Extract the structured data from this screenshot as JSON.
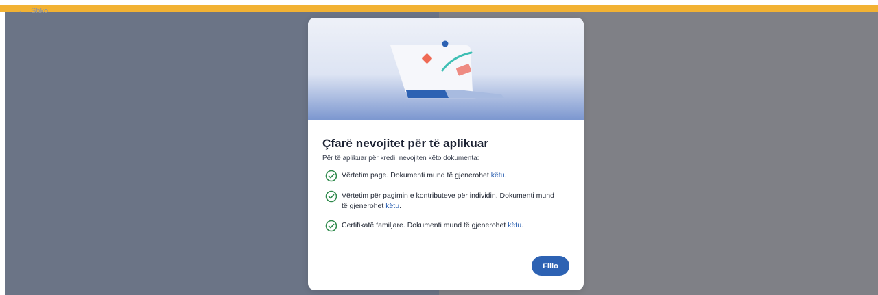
{
  "background": {
    "back_label": "Shko"
  },
  "modal": {
    "title": "Çfarë nevojitet për të aplikuar",
    "subtitle": "Për të aplikuar për kredi, nevojiten këto dokumenta:",
    "requirements": [
      {
        "text": "Vërtetim page. Dokumenti mund të gjenerohet ",
        "link": "këtu"
      },
      {
        "text": "Vërtetim për pagimin e kontributeve për individin. Dokumenti mund të gjenerohet ",
        "link": "këtu"
      },
      {
        "text": "Certifikatë familjare. Dokumenti mund të gjenerohet ",
        "link": "këtu"
      }
    ],
    "period": ".",
    "button_label": "Fillo"
  },
  "colors": {
    "topbar": "#f2b233",
    "accent": "#2d62b3",
    "check": "#2f8a4c"
  },
  "icons": {
    "check": "check-circle-icon",
    "illustration": "document-illustration"
  }
}
